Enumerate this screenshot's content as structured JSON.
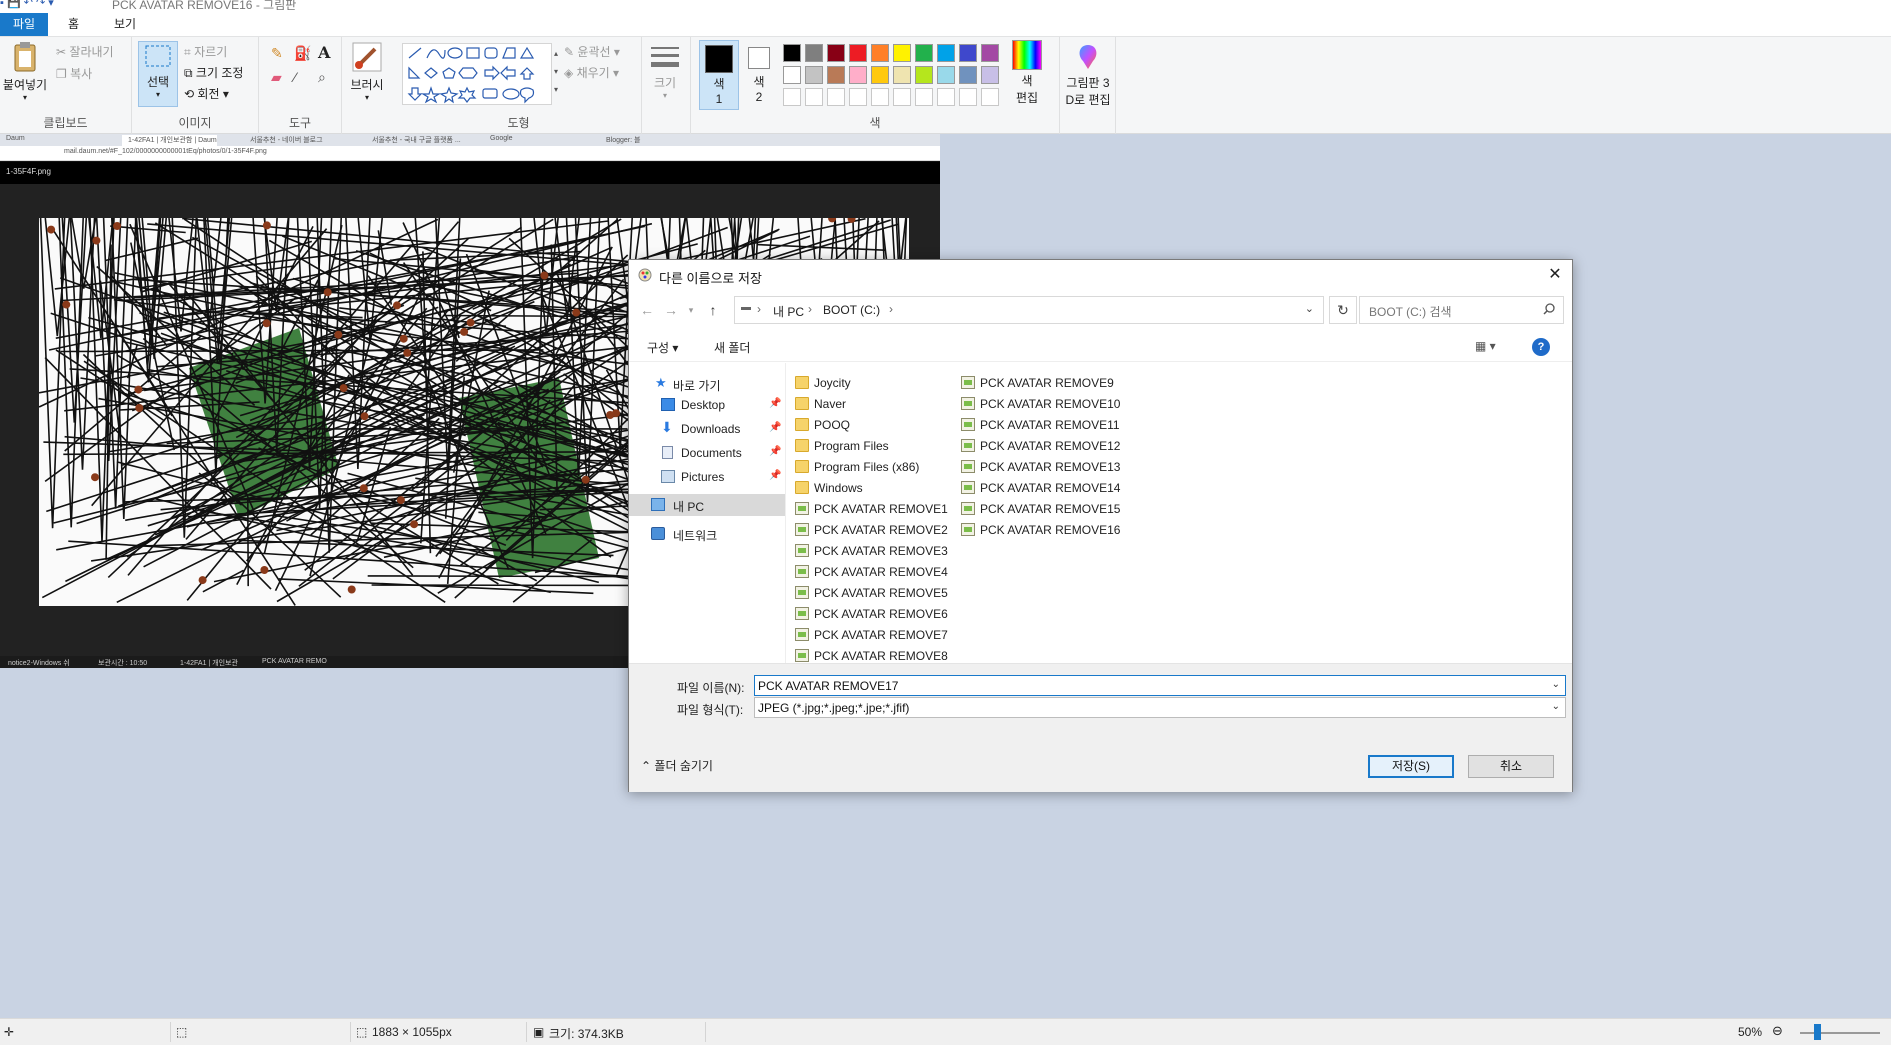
{
  "window": {
    "title": "PCK AVATAR REMOVE16 - 그림판"
  },
  "ribbon_tabs": [
    "파일",
    "홈",
    "보기"
  ],
  "ribbon": {
    "clipboard": {
      "paste": "붙여넣기",
      "cut": "잘라내기",
      "copy": "복사",
      "group": "클립보드"
    },
    "image": {
      "select": "선택",
      "crop": "자르기",
      "resize": "크기 조정",
      "rotate": "회전",
      "group": "이미지"
    },
    "tools": {
      "group": "도구"
    },
    "brushes": {
      "label": "브러시"
    },
    "shapes": {
      "outline": "윤곽선",
      "fill": "채우기",
      "group": "도형"
    },
    "size": {
      "label": "크기"
    },
    "colors": {
      "color1": "색\n1",
      "color1_a": "색",
      "color1_b": "1",
      "color2_a": "색",
      "color2_b": "2",
      "edit_a": "색",
      "edit_b": "편집",
      "group": "색",
      "palette_row1": [
        "#000000",
        "#7f7f7f",
        "#880015",
        "#ed1c24",
        "#ff7f27",
        "#fff200",
        "#22b14c",
        "#00a2e8",
        "#3f48cc",
        "#a349a4"
      ],
      "palette_row2": [
        "#ffffff",
        "#c3c3c3",
        "#b97a57",
        "#ffaec9",
        "#ffc90e",
        "#efe4b0",
        "#b5e61d",
        "#99d9ea",
        "#7092be",
        "#c8bfe7"
      ]
    },
    "paint3d": {
      "line1": "그림판 3",
      "line2": "D로 편집"
    }
  },
  "screenshot": {
    "tabs": [
      "Daum",
      "1-42FA1 | 개인보관함 | Daum",
      "서울추천 - 네이버 블로그",
      "서울추천 - 국내 구글 플랫폼 ...",
      "Google",
      "Blogger: 블"
    ],
    "address": "mail.daum.net/#F_102/0000000000001tEq/photos/0/1-35F4F.png",
    "file": "1-35F4F.png",
    "taskbar": [
      "notice2-Windows 쉬",
      "보관시간 : 10:50",
      "1-42FA1 | 개인보관",
      "PCK AVATAR REMO"
    ]
  },
  "dialog": {
    "title": "다른 이름으로 저장",
    "breadcrumb": [
      "내 PC",
      "BOOT (C:)"
    ],
    "search_placeholder": "BOOT (C:) 검색",
    "organize": "구성",
    "new_folder": "새 폴더",
    "nav": {
      "quick_access": "바로 가기",
      "desktop": "Desktop",
      "downloads": "Downloads",
      "documents": "Documents",
      "pictures": "Pictures",
      "this_pc": "내 PC",
      "network": "네트워크"
    },
    "folders": [
      "Joycity",
      "Naver",
      "POOQ",
      "Program Files",
      "Program Files (x86)",
      "Windows"
    ],
    "files_col1": [
      "PCK AVATAR REMOVE1",
      "PCK AVATAR REMOVE2",
      "PCK AVATAR REMOVE3",
      "PCK AVATAR REMOVE4",
      "PCK AVATAR REMOVE5",
      "PCK AVATAR REMOVE6",
      "PCK AVATAR REMOVE7",
      "PCK AVATAR REMOVE8"
    ],
    "files_col2": [
      "PCK AVATAR REMOVE9",
      "PCK AVATAR REMOVE10",
      "PCK AVATAR REMOVE11",
      "PCK AVATAR REMOVE12",
      "PCK AVATAR REMOVE13",
      "PCK AVATAR REMOVE14",
      "PCK AVATAR REMOVE15",
      "PCK AVATAR REMOVE16"
    ],
    "filename_label": "파일 이름(N):",
    "filename_value": "PCK AVATAR REMOVE17",
    "filetype_label": "파일 형식(T):",
    "filetype_value": "JPEG (*.jpg;*.jpeg;*.jpe;*.jfif)",
    "hide_folders": "폴더 숨기기",
    "save": "저장(S)",
    "cancel": "취소"
  },
  "statusbar": {
    "dimensions": "1883 × 1055px",
    "size": "크기: 374.3KB",
    "zoom": "50%"
  }
}
